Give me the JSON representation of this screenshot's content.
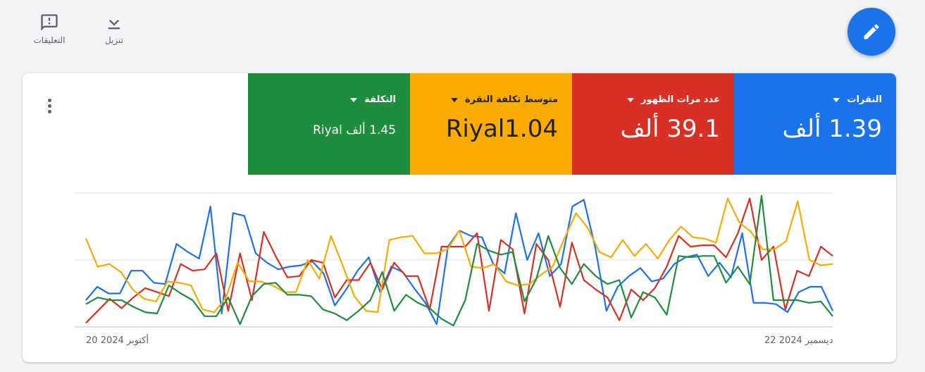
{
  "toolbar": {
    "download_label": "تنزيل",
    "feedback_label": "التعليقات",
    "download_icon": "download-icon",
    "feedback_icon": "feedback-icon",
    "edit_icon": "edit-pencil-icon"
  },
  "metrics": {
    "clicks": {
      "label": "النقرات",
      "value": "1.39 ألف",
      "color": "#1a73e8"
    },
    "impressions": {
      "label": "عدد مرات الظهور",
      "value": "39.1 ألف",
      "color": "#d93025"
    },
    "avg_cpc": {
      "label": "متوسط تكلفة النقرة",
      "value": "Riyal1.04",
      "color": "#f9ab00"
    },
    "cost": {
      "label": "التكلفة",
      "value": "1.45 ألف Riyal",
      "color": "#1e8e3e"
    }
  },
  "chart_data": {
    "type": "line",
    "x_start_label": "20 أكتوبر 2024",
    "x_end_label": "22 ديسمبر 2024",
    "ylim": [
      0,
      100
    ],
    "grid": true,
    "series": [
      {
        "color": "#1a73e8",
        "values": [
          20,
          30,
          25,
          25,
          42,
          42,
          33,
          32,
          62,
          56,
          51,
          90,
          10,
          85,
          83,
          55,
          48,
          43,
          45,
          46,
          49,
          40,
          16,
          28,
          42,
          52,
          26,
          45,
          41,
          29,
          18,
          2,
          60,
          72,
          68,
          67,
          47,
          40,
          85,
          50,
          70,
          38,
          47,
          90,
          95,
          60,
          12,
          30,
          38,
          44,
          34,
          36,
          47,
          52,
          54,
          38,
          48,
          37,
          70,
          18,
          18,
          17,
          11,
          26,
          30,
          30,
          12
        ]
      },
      {
        "color": "#d93025",
        "values": [
          3,
          12,
          21,
          14,
          22,
          29,
          26,
          23,
          47,
          42,
          43,
          55,
          12,
          55,
          20,
          71,
          53,
          37,
          38,
          50,
          48,
          22,
          35,
          35,
          48,
          28,
          48,
          38,
          38,
          13,
          60,
          60,
          60,
          70,
          12,
          65,
          58,
          10,
          62,
          50,
          15,
          63,
          35,
          28,
          22,
          5,
          28,
          20,
          29,
          45,
          68,
          60,
          61,
          61,
          52,
          70,
          96,
          50,
          60,
          13,
          42,
          38,
          60,
          53
        ]
      },
      {
        "color": "#f9ab00",
        "values": [
          66,
          45,
          47,
          41,
          28,
          21,
          19,
          34,
          33,
          31,
          13,
          11,
          22,
          48,
          34,
          34,
          31,
          26,
          26,
          50,
          36,
          68,
          46,
          23,
          12,
          11,
          65,
          67,
          68,
          55,
          55,
          58,
          72,
          45,
          44,
          47,
          34,
          31,
          32,
          39,
          45,
          66,
          85,
          74,
          56,
          52,
          65,
          53,
          62,
          51,
          65,
          75,
          67,
          66,
          63,
          96,
          78,
          71,
          58,
          58,
          64,
          94,
          50,
          46,
          47
        ]
      },
      {
        "color": "#1e8e3e",
        "values": [
          17,
          22,
          20,
          20,
          15,
          11,
          10,
          31,
          25,
          20,
          8,
          8,
          22,
          2,
          23,
          32,
          33,
          24,
          24,
          23,
          13,
          10,
          5,
          12,
          20,
          41,
          12,
          24,
          18,
          14,
          6,
          1,
          20,
          62,
          57,
          54,
          56,
          19,
          36,
          68,
          44,
          32,
          47,
          38,
          32,
          35,
          7,
          26,
          22,
          9,
          53,
          52,
          53,
          53,
          33,
          45,
          32,
          98,
          20,
          20,
          20,
          18,
          19,
          8
        ]
      }
    ]
  }
}
